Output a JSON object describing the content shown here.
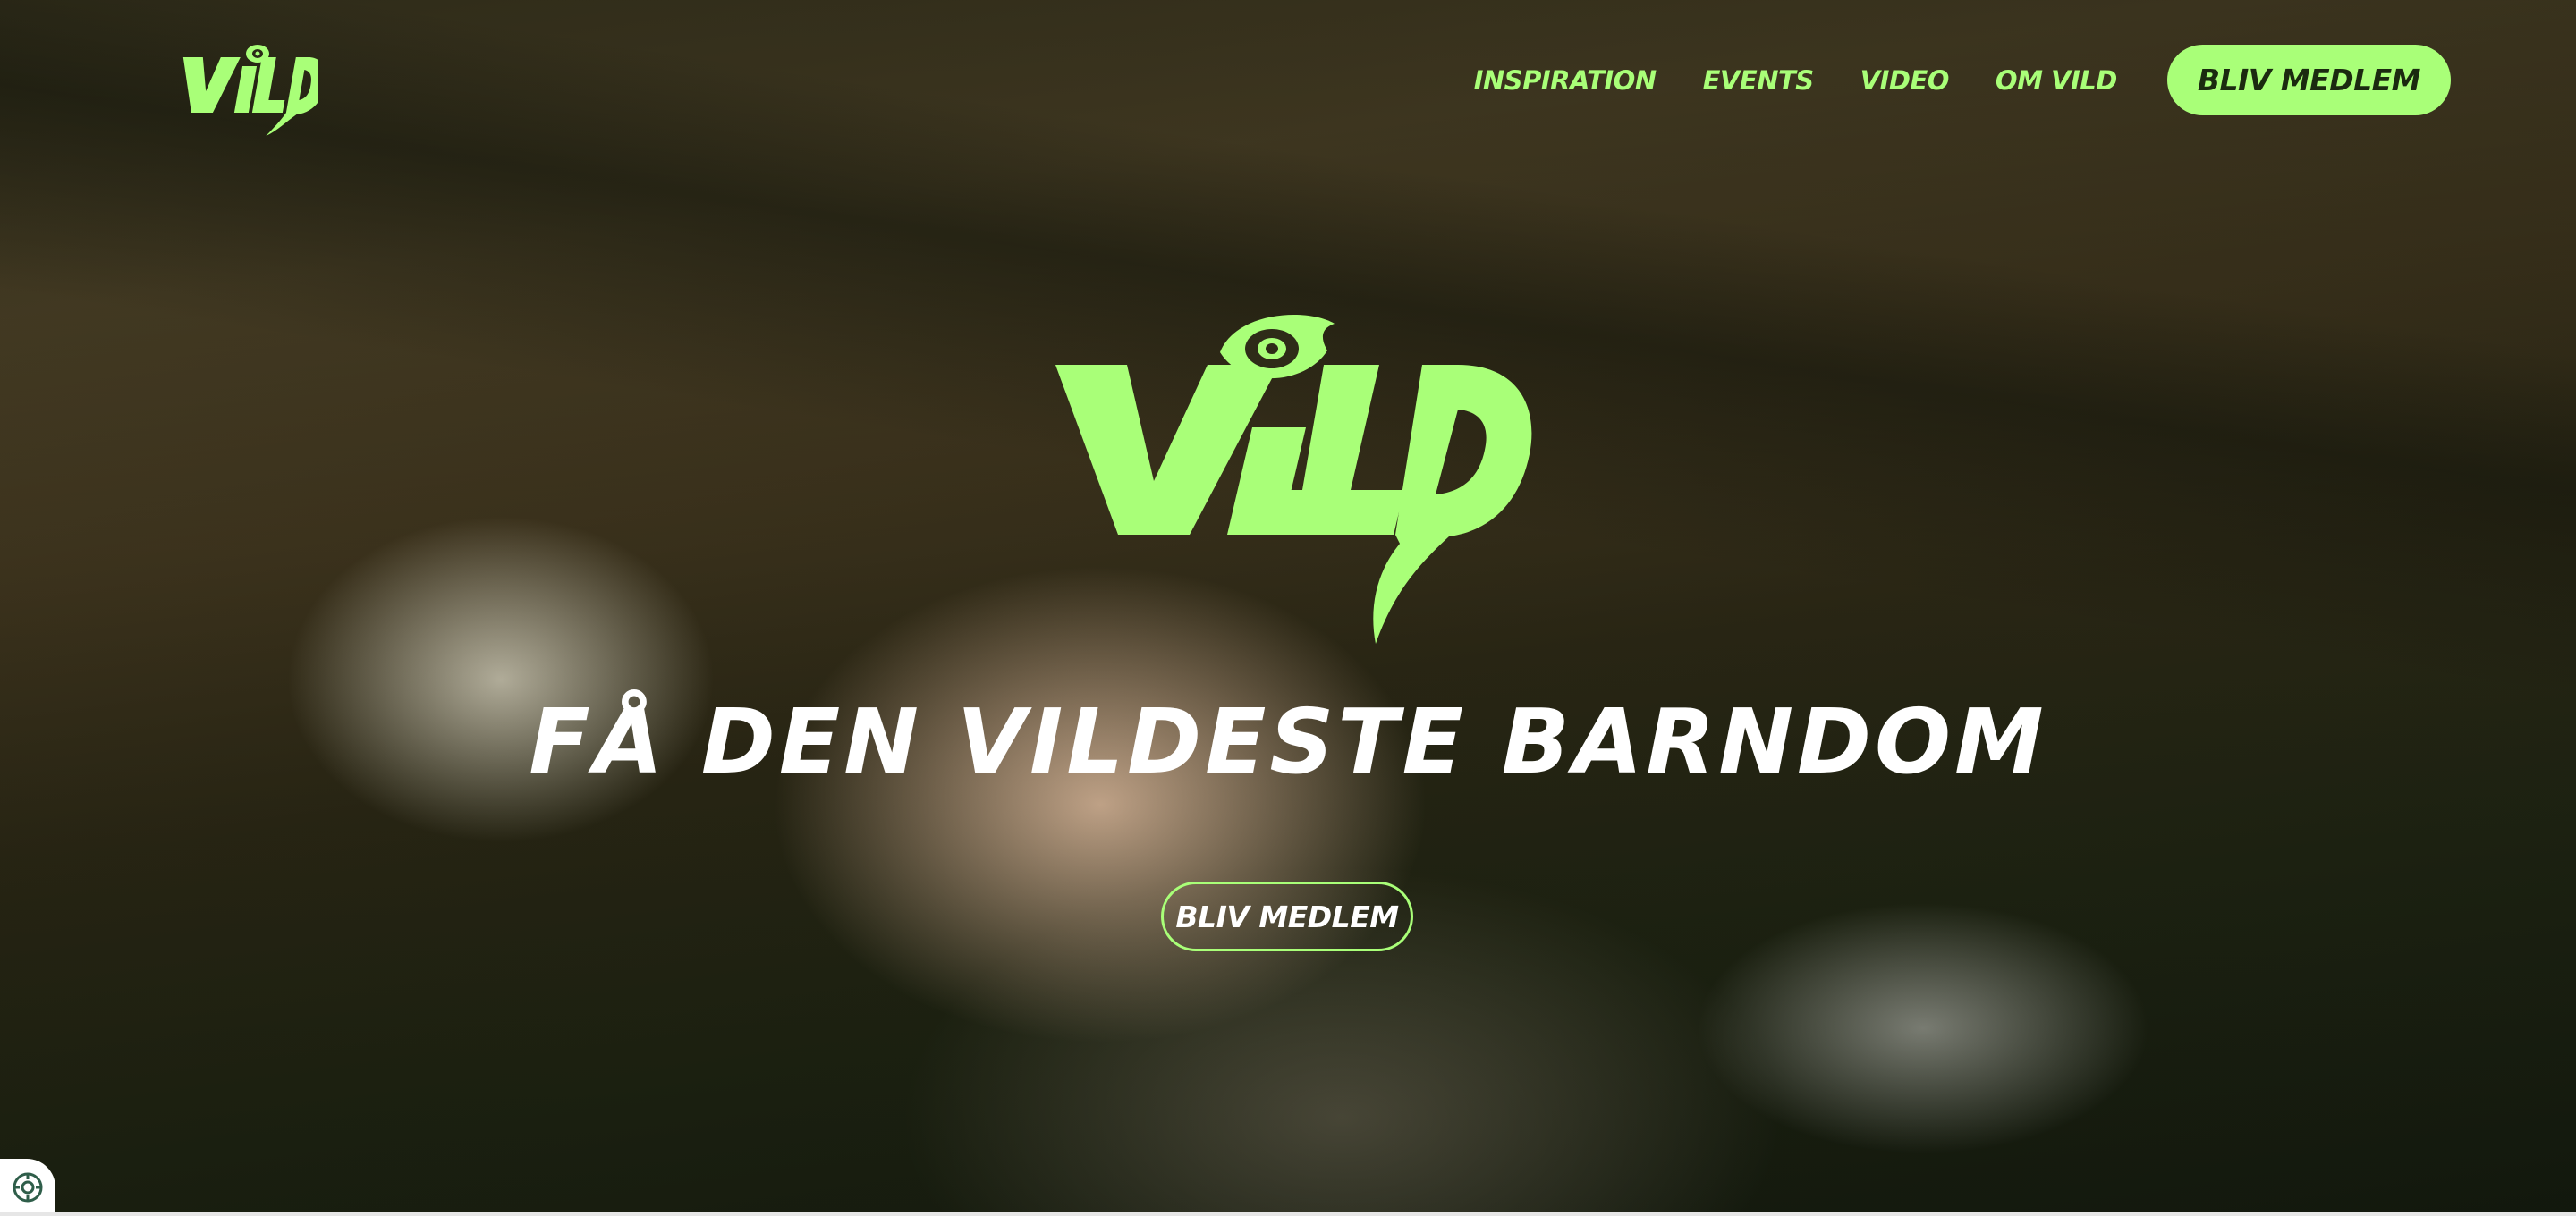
{
  "brand": {
    "logo_text": "VILD",
    "accent_color": "#a9ff78"
  },
  "nav": {
    "items": [
      {
        "label": "INSPIRATION"
      },
      {
        "label": "EVENTS"
      },
      {
        "label": "VIDEO"
      },
      {
        "label": "OM VILD"
      }
    ],
    "cta_label": "BLIV MEDLEM"
  },
  "hero": {
    "headline": "FÅ DEN VILDESTE BARNDOM",
    "cta_label": "BLIV MEDLEM"
  },
  "icons": {
    "cookie_settings": "cookie-settings-icon"
  }
}
